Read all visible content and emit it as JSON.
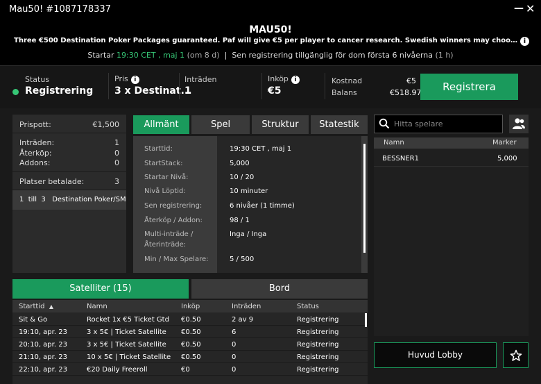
{
  "window": {
    "title": "Mau50! #1087178337",
    "minimize": "—",
    "close": "✕"
  },
  "header": {
    "title": "MAU50!",
    "description": "Three €500 Destination Poker Packages guaranteed. Paf will give €5 per player to cancer research. Swedish winners may choose seat in Swedish Championship",
    "info": "i",
    "start_prefix": "Startar",
    "start_time": "19:30 CET , maj 1",
    "start_relative": "(om 8 d)",
    "separator": "|",
    "late_reg": "Sen registrering tillgänglig för dom första 6 nivåerna",
    "late_reg_hours": "(1 h)"
  },
  "status": {
    "status_label": "Status",
    "status_value": "Registrering",
    "price_label": "Pris",
    "price_value": "3 x Destinat...",
    "entries_label": "Inträden",
    "entries_value": "1",
    "buyin_label": "Inköp",
    "buyin_value": "€5",
    "cost_label": "Kostnad",
    "cost_value": "€5",
    "balance_label": "Balans",
    "balance_value": "€518.97",
    "register_button": "Registrera",
    "colors": {
      "status_dot": "#36c776",
      "accent": "#1a9a5c"
    }
  },
  "left_panel": {
    "prizepool_label": "Prispott:",
    "prizepool_value": "€1,500",
    "entries_label": "Inträden:",
    "entries_value": "1",
    "rebuys_label": "Återköp:",
    "rebuys_value": "0",
    "addons_label": "Addons:",
    "addons_value": "0",
    "paid_label": "Platser betalade:",
    "paid_value": "3",
    "prize_row": "1  till  3   Destination Poker/SM"
  },
  "tabs": [
    "Allmänt",
    "Spel",
    "Struktur",
    "Statestik"
  ],
  "info_table": [
    {
      "k": "Starttid:",
      "v": "19:30 CET , maj 1"
    },
    {
      "k": "StartStack:",
      "v": "5,000"
    },
    {
      "k": "Startar Nivå:",
      "v": "10 / 20"
    },
    {
      "k": "Nivå Löptid:",
      "v": "10 minuter"
    },
    {
      "k": "Sen registrering:",
      "v": "6 nivåer (1 timme)"
    },
    {
      "k": "Återköp / Addon:",
      "v": "98 / 1"
    },
    {
      "k": "Multi-inträde / Återinträde:",
      "v": "Inga / Inga"
    },
    {
      "k": "Min / Max Spelare:",
      "v": "5 / 500"
    }
  ],
  "bottom_tabs": {
    "satellites": "Satelliter (15)",
    "tables": "Bord"
  },
  "satellites": {
    "headers": [
      "Starttid",
      "Namn",
      "Inköp",
      "Inträden",
      "Status"
    ],
    "sort_indicator": "▲",
    "rows": [
      [
        "Sit & Go",
        "Rocket 1x €5 Ticket Gtd",
        "€0.50",
        "2 av 9",
        "Registrering"
      ],
      [
        "19:10, apr. 23",
        "3 x 5€ | Ticket Satellite",
        "€0.50",
        "6",
        "Registrering"
      ],
      [
        "20:10, apr. 23",
        "3 x 5€ | Ticket Satellite",
        "€0.50",
        "0",
        "Registrering"
      ],
      [
        "21:10, apr. 23",
        "10 x 5€ | Ticket Satellite",
        "€0.50",
        "0",
        "Registrering"
      ],
      [
        "22:10, apr. 23",
        "€20 Daily Freeroll",
        "€0",
        "0",
        "Registrering"
      ]
    ]
  },
  "search": {
    "placeholder": "Hitta spelare"
  },
  "players": {
    "headers": [
      "Namn",
      "Marker"
    ],
    "rows": [
      [
        "BESSNER1",
        "5,000"
      ]
    ]
  },
  "lobby_button": "Huvud Lobby",
  "icons": [
    "search-icon",
    "players-icon",
    "star-icon",
    "info-icon",
    "sort-up-icon"
  ]
}
